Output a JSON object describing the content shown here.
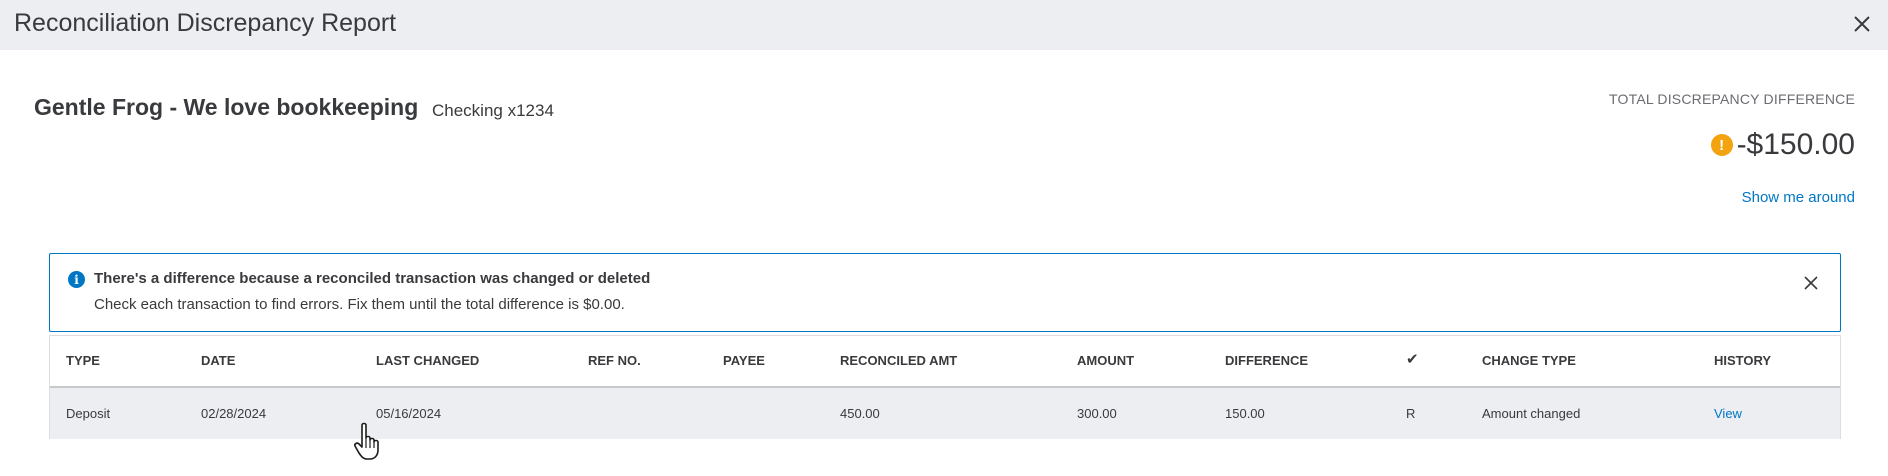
{
  "dialog": {
    "title": "Reconciliation Discrepancy Report",
    "close_icon": "close-icon"
  },
  "header": {
    "company": "Gentle Frog - We love bookkeeping",
    "account": "Checking x1234",
    "total_label": "TOTAL DISCREPANCY DIFFERENCE",
    "total_amount": "-$150.00",
    "warning_glyph": "!",
    "show_me_around": "Show me around"
  },
  "banner": {
    "info_glyph": "i",
    "title": "There's a difference because a reconciled transaction was changed or deleted",
    "text": "Check each transaction to find errors. Fix them until the total difference is $0.00."
  },
  "table": {
    "columns": [
      "TYPE",
      "DATE",
      "LAST CHANGED",
      "REF NO.",
      "PAYEE",
      "RECONCILED AMT",
      "AMOUNT",
      "DIFFERENCE",
      "✔",
      "CHANGE TYPE",
      "HISTORY"
    ],
    "rows": [
      {
        "type": "Deposit",
        "date": "02/28/2024",
        "last_changed": "05/16/2024",
        "ref_no": "",
        "payee": "",
        "reconciled_amt": "450.00",
        "amount": "300.00",
        "difference": "150.00",
        "status": "R",
        "change_type": "Amount changed",
        "history": "View"
      }
    ]
  },
  "colors": {
    "accent": "#0077c5",
    "warning": "#f2a30f",
    "header_bg": "#eceef1"
  }
}
